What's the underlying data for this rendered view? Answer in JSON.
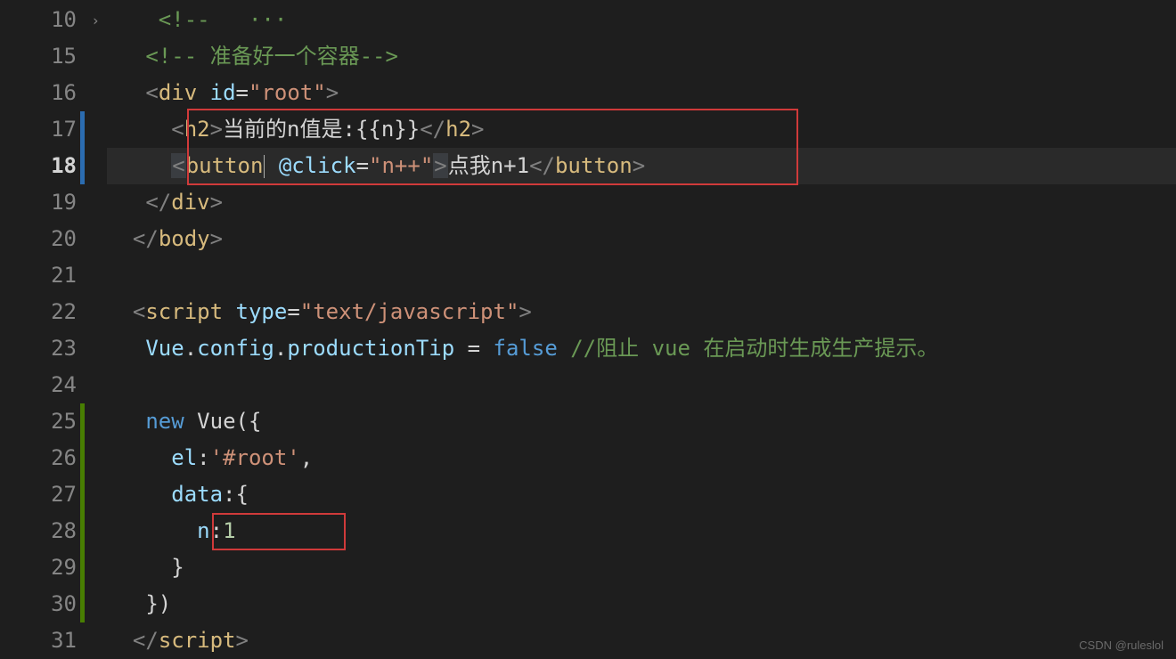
{
  "watermark": "CSDN @ruleslol",
  "gutter": {
    "start": 10,
    "end": 31,
    "current": 18,
    "fold_at": 10
  },
  "highlight_boxes": {
    "box1_lines": [
      17,
      18
    ],
    "box2_line": 28
  },
  "code": {
    "l10": {
      "comment_open": "<!--",
      "ellipsis": "···"
    },
    "l15": {
      "comment_open": "<!--",
      "comment_text": " 准备好一个容器",
      "comment_close": "-->"
    },
    "l16": {
      "open": "<",
      "tag": "div",
      "attr": "id",
      "eq": "=",
      "val": "\"root\"",
      "close": ">"
    },
    "l17": {
      "open": "<",
      "tag": "h2",
      "close": ">",
      "txt": "当前的n值是:{{n}}",
      "end_open": "</",
      "end_close": ">"
    },
    "l18": {
      "open": "<",
      "tag": "button",
      "attr": "@click",
      "eq": "=",
      "val": "\"n++\"",
      "close": ">",
      "txt": "点我n+1",
      "end_open": "</",
      "end_close": ">"
    },
    "l19": {
      "end_open": "</",
      "tag": "div",
      "end_close": ">"
    },
    "l20": {
      "end_open": "</",
      "tag": "body",
      "end_close": ">"
    },
    "l22": {
      "open": "<",
      "tag": "script",
      "attr": "type",
      "eq": "=",
      "val": "\"text/javascript\"",
      "close": ">"
    },
    "l23": {
      "obj": "Vue",
      "dot1": ".",
      "p1": "config",
      "dot2": ".",
      "p2": "productionTip",
      "eq": " = ",
      "val": "false",
      "comment": " //阻止 vue 在启动时生成生产提示。"
    },
    "l25": {
      "kw": "new",
      "cls": " Vue",
      "open": "({"
    },
    "l26": {
      "key": "el",
      "colon": ":",
      "val": "'#root'",
      "comma": ","
    },
    "l27": {
      "key": "data",
      "colon": ":",
      "open": "{"
    },
    "l28": {
      "key": "n",
      "colon": ":",
      "val": "1"
    },
    "l29": {
      "close": "}"
    },
    "l30": {
      "close": "})"
    },
    "l31": {
      "end_open": "</",
      "tag": "script",
      "end_close": ">"
    }
  }
}
